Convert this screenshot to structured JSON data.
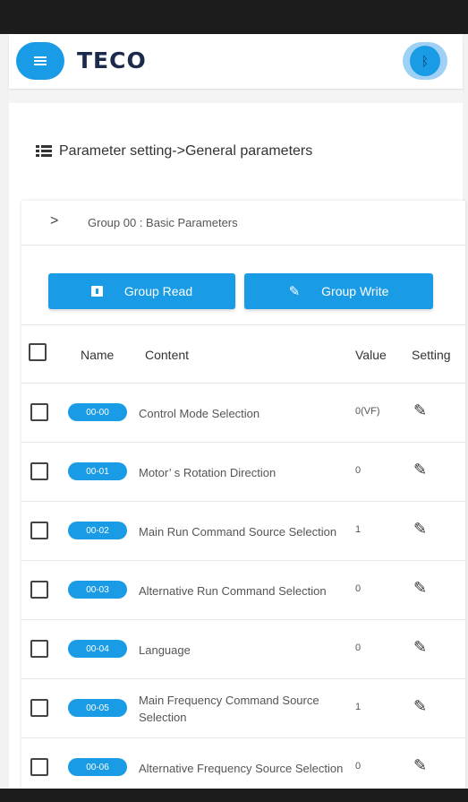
{
  "header": {
    "menu_icon": "hamburger-menu-icon",
    "logo_text": "TECO",
    "bluetooth_icon": "bluetooth-icon"
  },
  "breadcrumb": {
    "icon": "list-icon",
    "text": "Parameter setting->General parameters"
  },
  "group": {
    "chevron": ">",
    "title": "Group 00 : Basic Parameters"
  },
  "actions": {
    "read_label": "Group Read",
    "read_icon": "download-icon",
    "write_label": "Group Write",
    "write_icon": "pencil-icon"
  },
  "table": {
    "columns": {
      "name": "Name",
      "content": "Content",
      "value": "Value",
      "setting": "Setting"
    },
    "rows": [
      {
        "code": "00-00",
        "content": "Control Mode Selection",
        "value": "0(VF)"
      },
      {
        "code": "00-01",
        "content": "Motor’ s Rotation Direction",
        "value": "0"
      },
      {
        "code": "00-02",
        "content": "Main Run Command Source Selection",
        "value": "1"
      },
      {
        "code": "00-03",
        "content": "Alternative Run Command Selection",
        "value": "0"
      },
      {
        "code": "00-04",
        "content": "Language",
        "value": "0"
      },
      {
        "code": "00-05",
        "content": "Main Frequency Command Source Selection",
        "value": "1"
      },
      {
        "code": "00-06",
        "content": "Alternative Frequency Source Selection",
        "value": "0"
      }
    ]
  },
  "colors": {
    "accent": "#1a9be6",
    "logo": "#1b2a4a",
    "status_bar": "#1c1c1c"
  }
}
